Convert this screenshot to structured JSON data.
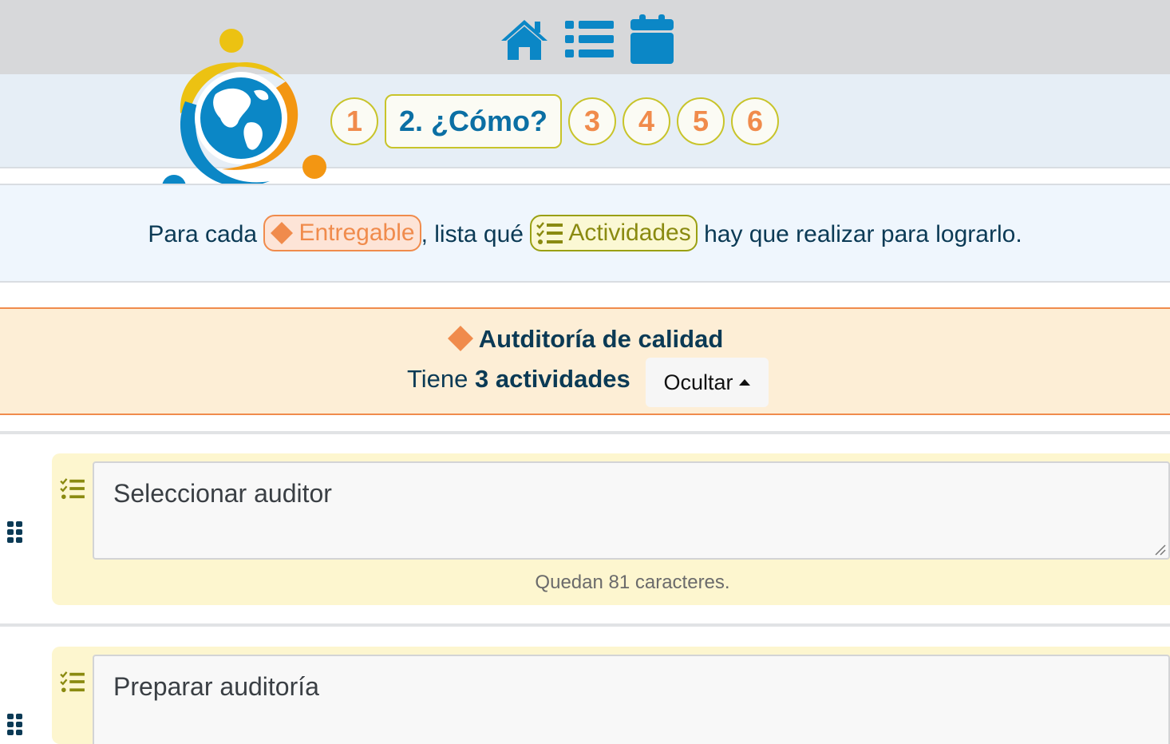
{
  "nav": {
    "home_icon": "home-icon",
    "list_icon": "list-icon",
    "calendar_icon": "calendar-icon"
  },
  "logo": "globe-people-logo",
  "steps": [
    {
      "label": "1",
      "active": false
    },
    {
      "label": "2. ¿Cómo?",
      "active": true
    },
    {
      "label": "3",
      "active": false
    },
    {
      "label": "4",
      "active": false
    },
    {
      "label": "5",
      "active": false
    },
    {
      "label": "6",
      "active": false
    }
  ],
  "instruction": {
    "prefix": "Para cada",
    "deliverable_tag": "Entregable",
    "middle": ", lista qué",
    "activities_tag": "Actividades",
    "suffix": "hay que realizar para lograrlo."
  },
  "deliverable": {
    "title": "Autditoría de calidad",
    "count_prefix": "Tiene",
    "count_bold": "3 actividades",
    "toggle_label": "Ocultar"
  },
  "activities": [
    {
      "text": "Seleccionar auditor",
      "counter": "Quedan 81 caracteres."
    },
    {
      "text": "Preparar auditoría",
      "counter": ""
    }
  ],
  "colors": {
    "brand_blue": "#0b87c6",
    "orange": "#f08b4c",
    "olive": "#9aa012",
    "dark_text": "#0b3a55"
  }
}
